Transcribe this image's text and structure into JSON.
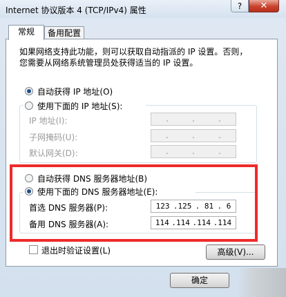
{
  "window": {
    "title": "Internet 协议版本 4 (TCP/IPv4) 属性",
    "help_glyph": "?",
    "close_glyph": "✕"
  },
  "tabs": [
    {
      "label": "常规",
      "active": true
    },
    {
      "label": "备用配置",
      "active": false
    }
  ],
  "description": {
    "line1": "如果网络支持此功能，则可以获取自动指派的 IP 设置。否则，",
    "line2": "您需要从网络系统管理员处获得适当的 IP 设置。"
  },
  "ip_section": {
    "auto_label": "自动获得 IP 地址(O)",
    "manual_label": "使用下面的 IP 地址(S):",
    "selected": "auto",
    "fields": [
      {
        "label": "IP 地址(I):",
        "value": [
          ".",
          ".",
          "."
        ]
      },
      {
        "label": "子网掩码(U):",
        "value": [
          ".",
          ".",
          "."
        ]
      },
      {
        "label": "默认网关(D):",
        "value": [
          ".",
          ".",
          "."
        ]
      }
    ]
  },
  "dns_section": {
    "auto_label": "自动获得 DNS 服务器地址(B)",
    "manual_label": "使用下面的 DNS 服务器地址(E):",
    "selected": "manual",
    "preferred": {
      "label": "首选 DNS 服务器(P):",
      "octets": [
        "123",
        ".125",
        ". 81",
        ".  6"
      ]
    },
    "alternate": {
      "label": "备用 DNS 服务器(A):",
      "octets": [
        "114",
        ".114",
        ".114",
        ".114"
      ]
    }
  },
  "validate_label": "退出时验证设置(L)",
  "advanced_label": "高级(V)...",
  "ok_label": "确定",
  "colors": {
    "highlight": "#ef2a2a",
    "radio_dot": "#1d4f8a"
  }
}
